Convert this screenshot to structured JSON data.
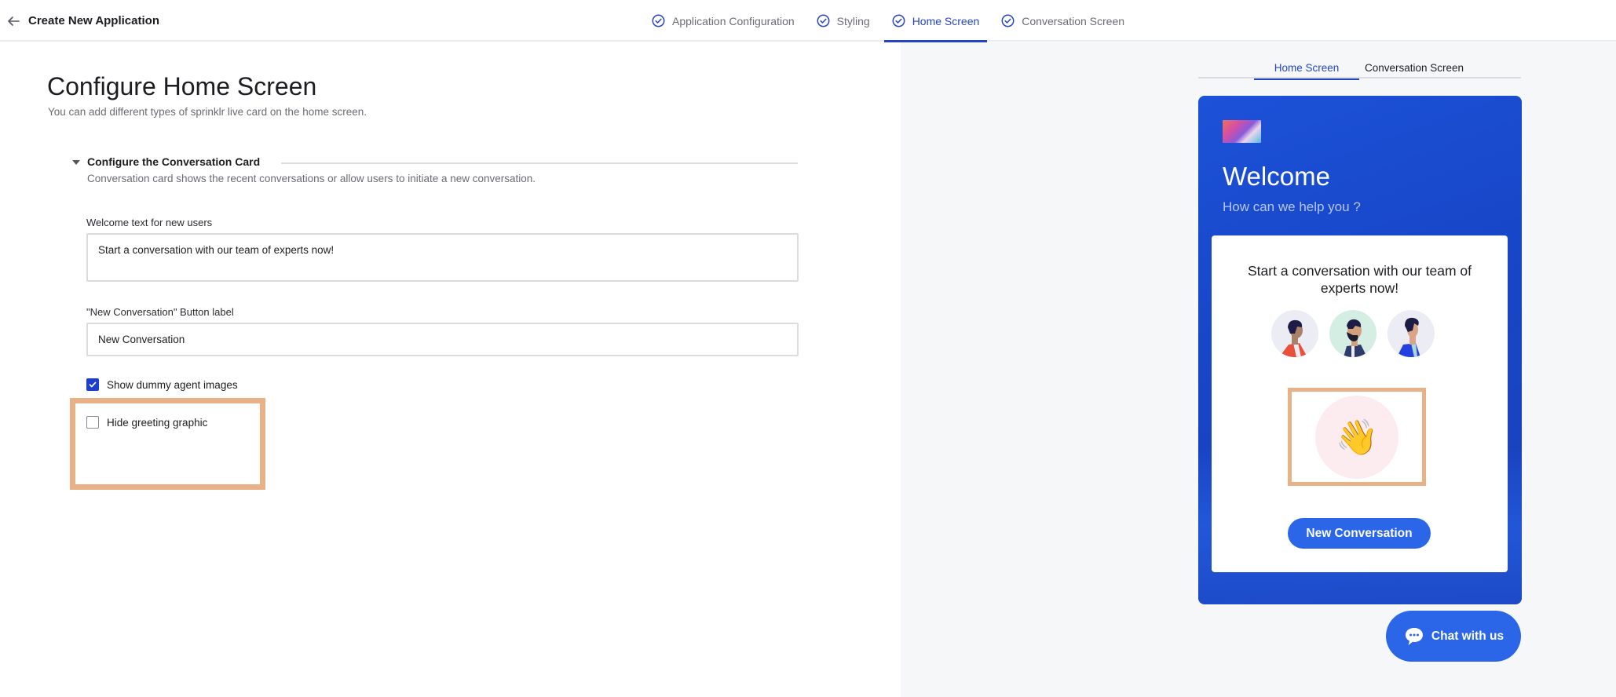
{
  "header": {
    "title": "Create New Application",
    "steps": [
      {
        "label": "Application Configuration",
        "state": "complete"
      },
      {
        "label": "Styling",
        "state": "complete"
      },
      {
        "label": "Home Screen",
        "state": "active"
      },
      {
        "label": "Conversation Screen",
        "state": "complete"
      }
    ]
  },
  "main": {
    "title": "Configure Home Screen",
    "subtitle": "You can add different types of sprinklr live card on the home screen.",
    "section": {
      "title": "Configure the Conversation Card",
      "description": "Conversation card shows the recent conversations or allow users to initiate a new conversation.",
      "expanded": true
    },
    "fields": {
      "welcome_label": "Welcome text for new users",
      "welcome_value": "Start a conversation with our team of experts now!",
      "button_label_label": "\"New Conversation\" Button label",
      "button_label_value": "New Conversation"
    },
    "checkboxes": [
      {
        "label": "Show dummy agent images",
        "checked": true
      },
      {
        "label": "Hide greeting graphic",
        "checked": false
      }
    ]
  },
  "preview": {
    "tabs": [
      {
        "label": "Home Screen",
        "active": true
      },
      {
        "label": "Conversation Screen",
        "active": false
      }
    ],
    "welcome": "Welcome",
    "help": "How can we help you ?",
    "card_text": "Start a conversation with our team of experts now!",
    "greeting_emoji": "👋",
    "new_conversation_button": "New Conversation",
    "chat_button": "Chat with us"
  },
  "colors": {
    "accent": "#2444c4",
    "checkbox": "#1e3fcc",
    "widget_blue": "#2b66e8",
    "highlight": "#e8b188"
  }
}
